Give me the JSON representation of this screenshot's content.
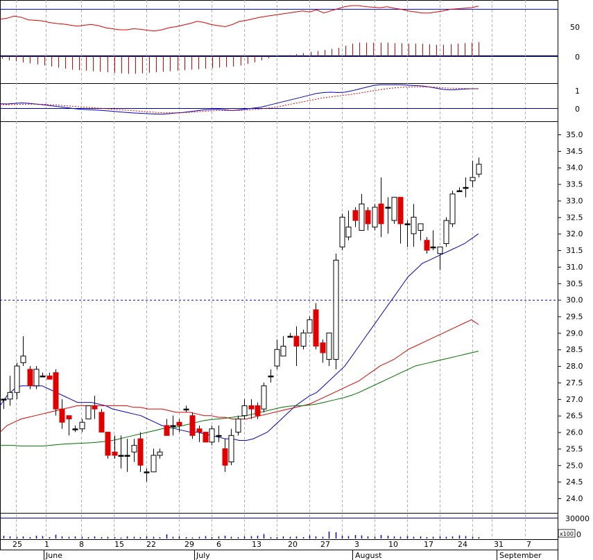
{
  "chart_data": [
    {
      "type": "line",
      "panel": "oscillator",
      "title": "",
      "y_ticks": [
        "50",
        "0"
      ],
      "reference_levels": [
        85
      ],
      "colors": {
        "line": "#e00000",
        "reference": "#0000aa"
      },
      "x": [
        "2009-05-22",
        "2009-05-25",
        "2009-05-26",
        "2009-05-27",
        "2009-05-28",
        "2009-05-29",
        "2009-06-01",
        "2009-06-02",
        "2009-06-03",
        "2009-06-04",
        "2009-06-05",
        "2009-06-08",
        "2009-06-09",
        "2009-06-10",
        "2009-06-11",
        "2009-06-12",
        "2009-06-15",
        "2009-06-16",
        "2009-06-17",
        "2009-06-18",
        "2009-06-19",
        "2009-06-22",
        "2009-06-23",
        "2009-06-24",
        "2009-06-25",
        "2009-06-26",
        "2009-06-29",
        "2009-06-30",
        "2009-07-01",
        "2009-07-02",
        "2009-07-03",
        "2009-07-06",
        "2009-07-07",
        "2009-07-08",
        "2009-07-09",
        "2009-07-10",
        "2009-07-13",
        "2009-07-14",
        "2009-07-15",
        "2009-07-16",
        "2009-07-17",
        "2009-07-20",
        "2009-07-21",
        "2009-07-22",
        "2009-07-23",
        "2009-07-24",
        "2009-07-27",
        "2009-07-28",
        "2009-07-29",
        "2009-07-30",
        "2009-07-31",
        "2009-08-03",
        "2009-08-04",
        "2009-08-05",
        "2009-08-06",
        "2009-08-07",
        "2009-08-10",
        "2009-08-11",
        "2009-08-12",
        "2009-08-13",
        "2009-08-14",
        "2009-08-17",
        "2009-08-18",
        "2009-08-19",
        "2009-08-20",
        "2009-08-21",
        "2009-08-24",
        "2009-08-25",
        "2009-08-26"
      ],
      "values": [
        66,
        68,
        72,
        70,
        65,
        64,
        63,
        60,
        58,
        57,
        55,
        53,
        55,
        56,
        54,
        50,
        48,
        46,
        46,
        48,
        47,
        45,
        44,
        46,
        50,
        52,
        55,
        58,
        62,
        60,
        56,
        54,
        52,
        56,
        62,
        64,
        67,
        70,
        72,
        74,
        76,
        78,
        80,
        82,
        80,
        84,
        78,
        82,
        86,
        90,
        92,
        92,
        90,
        89,
        88,
        90,
        87,
        85,
        82,
        80,
        78,
        78,
        80,
        82,
        85,
        86,
        87,
        88,
        91
      ]
    },
    {
      "type": "bar",
      "panel": "histogram",
      "title": "",
      "y_ticks": [
        "0"
      ],
      "colors": {
        "bar": "#e00000",
        "zero": "#0000aa"
      },
      "values": [
        -0.05,
        -0.08,
        -0.1,
        -0.12,
        -0.14,
        -0.16,
        -0.18,
        -0.2,
        -0.22,
        -0.24,
        -0.26,
        -0.27,
        -0.28,
        -0.29,
        -0.3,
        -0.31,
        -0.32,
        -0.33,
        -0.34,
        -0.34,
        -0.33,
        -0.32,
        -0.31,
        -0.3,
        -0.29,
        -0.28,
        -0.27,
        -0.26,
        -0.25,
        -0.24,
        -0.23,
        -0.22,
        -0.21,
        -0.2,
        -0.18,
        -0.15,
        -0.12,
        -0.08,
        -0.04,
        0,
        0,
        0.02,
        0.04,
        0.06,
        0.08,
        0.1,
        0.12,
        0.14,
        0.16,
        0.2,
        0.24,
        0.26,
        0.26,
        0.26,
        0.26,
        0.26,
        0.25,
        0.25,
        0.24,
        0.24,
        0.24,
        0.23,
        0.22,
        0.22,
        0.23,
        0.24,
        0.25,
        0.26,
        0.27
      ]
    },
    {
      "type": "line",
      "panel": "macd",
      "title": "",
      "y_ticks": [
        "1",
        "0"
      ],
      "colors": {
        "macd": "#0000cc",
        "signal": "#e00000",
        "zero": "#0000aa"
      },
      "series": [
        {
          "values": [
            0.25,
            0.24,
            0.27,
            0.3,
            0.28,
            0.24,
            0.2,
            0.15,
            0.1,
            0.05,
            0.0,
            -0.05,
            -0.08,
            -0.1,
            -0.12,
            -0.15,
            -0.18,
            -0.22,
            -0.25,
            -0.28,
            -0.3,
            -0.32,
            -0.34,
            -0.35,
            -0.32,
            -0.28,
            -0.25,
            -0.2,
            -0.15,
            -0.1,
            -0.08,
            -0.06,
            -0.1,
            -0.14,
            -0.1,
            -0.05,
            0.0,
            0.05,
            0.15,
            0.25,
            0.35,
            0.45,
            0.55,
            0.65,
            0.75,
            0.85,
            0.9,
            0.92,
            0.9,
            0.92,
            1.0,
            1.1,
            1.2,
            1.3,
            1.35,
            1.35,
            1.35,
            1.35,
            1.32,
            1.3,
            1.28,
            1.22,
            1.15,
            1.08,
            1.05,
            1.07,
            1.1,
            1.12,
            1.12
          ]
        },
        {
          "values": [
            0.2,
            0.2,
            0.21,
            0.22,
            0.23,
            0.23,
            0.22,
            0.2,
            0.18,
            0.15,
            0.12,
            0.09,
            0.06,
            0.03,
            0.0,
            -0.03,
            -0.06,
            -0.09,
            -0.12,
            -0.15,
            -0.18,
            -0.21,
            -0.24,
            -0.26,
            -0.27,
            -0.27,
            -0.26,
            -0.24,
            -0.21,
            -0.18,
            -0.16,
            -0.14,
            -0.14,
            -0.14,
            -0.13,
            -0.11,
            -0.08,
            -0.05,
            0.0,
            0.05,
            0.12,
            0.2,
            0.28,
            0.36,
            0.44,
            0.52,
            0.6,
            0.65,
            0.7,
            0.75,
            0.8,
            0.86,
            0.93,
            1.0,
            1.07,
            1.12,
            1.17,
            1.2,
            1.22,
            1.23,
            1.23,
            1.22,
            1.2,
            1.17,
            1.15,
            1.14,
            1.13,
            1.12,
            1.12
          ]
        }
      ]
    },
    {
      "type": "candlestick",
      "panel": "price",
      "title": "",
      "ylim": [
        23.5,
        35.5
      ],
      "y_ticks": [
        "35.0",
        "34.5",
        "34.0",
        "33.5",
        "33.0",
        "32.5",
        "32.0",
        "31.5",
        "31.0",
        "30.5",
        "30.0",
        "29.5",
        "29.0",
        "28.5",
        "28.0",
        "27.5",
        "27.0",
        "26.5",
        "26.0",
        "25.5",
        "25.0",
        "24.5",
        "24.0"
      ],
      "reference_level": 30.0,
      "colors": {
        "up": "#ffffff",
        "down": "#e00000",
        "doji": "#000000",
        "ma_blue": "#0000cc",
        "ma_red": "#e00000",
        "ma_green": "#007000",
        "ref": "#0000aa"
      },
      "ohlc": [
        [
          27.0,
          27.0,
          26.7,
          27.0
        ],
        [
          27.0,
          27.7,
          26.8,
          27.2
        ],
        [
          27.2,
          28.1,
          27.0,
          28.0
        ],
        [
          28.1,
          28.9,
          28.0,
          28.3
        ],
        [
          27.9,
          28.0,
          27.3,
          27.4
        ],
        [
          27.4,
          28.0,
          27.3,
          27.9
        ],
        [
          27.7,
          27.8,
          27.7,
          27.7
        ],
        [
          27.7,
          27.8,
          27.6,
          27.6
        ],
        [
          27.8,
          27.9,
          26.5,
          26.7
        ],
        [
          26.7,
          27.0,
          26.1,
          26.3
        ],
        [
          26.5,
          26.5,
          25.9,
          26.4
        ],
        [
          26.1,
          26.2,
          26.0,
          26.1
        ],
        [
          26.1,
          26.4,
          26.0,
          26.3
        ],
        [
          26.4,
          26.8,
          26.4,
          26.8
        ],
        [
          26.8,
          27.1,
          26.4,
          26.7
        ],
        [
          26.6,
          26.7,
          26.0,
          26.0
        ],
        [
          26.0,
          26.0,
          25.2,
          25.3
        ],
        [
          25.4,
          25.9,
          25.2,
          25.3
        ],
        [
          25.3,
          25.9,
          24.9,
          25.3
        ],
        [
          25.3,
          25.8,
          24.8,
          25.3
        ],
        [
          25.4,
          25.8,
          25.1,
          25.6
        ],
        [
          25.8,
          26.0,
          24.8,
          25.0
        ],
        [
          24.8,
          24.9,
          24.5,
          24.8
        ],
        [
          24.8,
          25.5,
          24.8,
          25.3
        ],
        [
          25.3,
          25.5,
          25.2,
          25.4
        ],
        [
          26.2,
          26.4,
          25.9,
          25.9
        ],
        [
          26.2,
          26.5,
          25.9,
          26.2
        ],
        [
          26.3,
          26.4,
          26.0,
          26.2
        ],
        [
          26.7,
          26.8,
          26.6,
          26.7
        ],
        [
          26.5,
          26.6,
          25.8,
          25.9
        ],
        [
          26.1,
          26.2,
          25.7,
          26.0
        ],
        [
          26.0,
          26.0,
          25.7,
          25.7
        ],
        [
          25.7,
          26.2,
          25.6,
          26.1
        ],
        [
          25.9,
          26.2,
          25.7,
          25.9
        ],
        [
          25.5,
          25.8,
          24.8,
          25.0
        ],
        [
          25.1,
          26.1,
          25.0,
          25.9
        ],
        [
          26.0,
          26.5,
          25.9,
          26.4
        ],
        [
          26.5,
          27.0,
          26.4,
          26.8
        ],
        [
          26.8,
          27.0,
          26.4,
          26.7
        ],
        [
          26.8,
          26.9,
          26.4,
          26.5
        ],
        [
          26.7,
          27.5,
          26.6,
          27.4
        ],
        [
          27.7,
          27.9,
          27.5,
          27.7
        ],
        [
          28.0,
          28.8,
          27.9,
          28.5
        ],
        [
          28.3,
          28.9,
          28.3,
          28.6
        ],
        [
          28.9,
          29.0,
          28.9,
          28.9
        ],
        [
          28.9,
          29.2,
          28.0,
          28.6
        ],
        [
          28.6,
          29.1,
          28.5,
          29.0
        ],
        [
          29.0,
          29.5,
          29.0,
          29.4
        ],
        [
          29.7,
          29.9,
          28.5,
          28.6
        ],
        [
          28.7,
          28.8,
          28.1,
          28.4
        ],
        [
          28.2,
          29.0,
          28.0,
          29.0
        ],
        [
          28.2,
          31.4,
          27.9,
          31.2
        ],
        [
          31.6,
          32.6,
          31.5,
          32.5
        ],
        [
          31.9,
          32.7,
          31.8,
          32.2
        ],
        [
          32.7,
          32.8,
          32.2,
          32.4
        ],
        [
          32.1,
          33.2,
          32.1,
          32.9
        ],
        [
          32.7,
          32.8,
          32.1,
          32.3
        ],
        [
          32.2,
          32.9,
          32.1,
          32.8
        ],
        [
          32.9,
          33.7,
          31.9,
          32.3
        ],
        [
          32.8,
          33.1,
          32.0,
          32.8
        ],
        [
          32.4,
          33.1,
          32.3,
          33.1
        ],
        [
          33.1,
          33.1,
          31.7,
          32.3
        ],
        [
          32.3,
          32.4,
          31.6,
          32.3
        ],
        [
          32.0,
          32.9,
          31.6,
          32.5
        ],
        [
          32.1,
          32.3,
          31.8,
          32.3
        ],
        [
          31.8,
          31.9,
          31.4,
          31.5
        ],
        [
          31.6,
          32.1,
          31.5,
          31.6
        ],
        [
          31.4,
          31.5,
          30.9,
          31.6
        ],
        [
          31.7,
          32.5,
          31.6,
          32.4
        ],
        [
          32.3,
          33.3,
          32.2,
          33.2
        ],
        [
          33.3,
          33.4,
          33.3,
          33.3
        ],
        [
          33.4,
          33.7,
          33.1,
          33.4
        ],
        [
          33.6,
          34.2,
          33.4,
          33.7
        ],
        [
          33.8,
          34.3,
          33.7,
          34.1
        ]
      ],
      "moving_averages": [
        {
          "color": "ma_blue",
          "values": [
            26.8,
            27.1,
            27.3,
            27.4,
            27.4,
            27.4,
            27.4,
            27.3,
            27.2,
            27.1,
            27.0,
            26.9,
            26.9,
            26.9,
            26.85,
            26.8,
            26.7,
            26.65,
            26.6,
            26.55,
            26.5,
            26.4,
            26.3,
            26.2,
            26.15,
            26.1,
            26.05,
            26.0,
            26.0,
            25.95,
            25.9,
            25.85,
            25.8,
            25.8,
            25.75,
            25.75,
            25.8,
            25.9,
            26.0,
            26.2,
            26.4,
            26.6,
            26.8,
            26.95,
            27.1,
            27.2,
            27.4,
            27.6,
            27.8,
            28.0,
            28.3,
            28.6,
            28.9,
            29.2,
            29.5,
            29.8,
            30.1,
            30.4,
            30.7,
            30.9,
            31.1,
            31.2,
            31.3,
            31.4,
            31.5,
            31.6,
            31.7,
            31.85,
            32.0
          ]
        },
        {
          "color": "ma_red",
          "values": [
            26.0,
            26.2,
            26.3,
            26.4,
            26.45,
            26.5,
            26.55,
            26.6,
            26.65,
            26.7,
            26.75,
            26.8,
            26.8,
            26.8,
            26.8,
            26.8,
            26.8,
            26.8,
            26.8,
            26.75,
            26.75,
            26.7,
            26.7,
            26.7,
            26.65,
            26.6,
            26.6,
            26.6,
            26.55,
            26.5,
            26.5,
            26.45,
            26.45,
            26.4,
            26.4,
            26.4,
            26.45,
            26.5,
            26.55,
            26.6,
            26.65,
            26.7,
            26.75,
            26.8,
            26.85,
            26.95,
            27.05,
            27.15,
            27.25,
            27.35,
            27.45,
            27.55,
            27.7,
            27.85,
            28.0,
            28.1,
            28.2,
            28.35,
            28.5,
            28.6,
            28.7,
            28.8,
            28.9,
            29.0,
            29.1,
            29.2,
            29.3,
            29.4,
            29.25
          ]
        },
        {
          "color": "ma_green",
          "values": [
            25.6,
            25.6,
            25.6,
            25.58,
            25.58,
            25.58,
            25.58,
            25.6,
            25.62,
            25.64,
            25.65,
            25.66,
            25.67,
            25.68,
            25.7,
            25.72,
            25.75,
            25.8,
            25.85,
            25.9,
            25.95,
            26.0,
            26.05,
            26.1,
            26.12,
            26.15,
            26.2,
            26.25,
            26.3,
            26.35,
            26.38,
            26.4,
            26.42,
            26.45,
            26.48,
            26.5,
            26.55,
            26.6,
            26.65,
            26.7,
            26.75,
            26.78,
            26.8,
            26.8,
            26.82,
            26.85,
            26.9,
            26.95,
            27.0,
            27.05,
            27.12,
            27.2,
            27.3,
            27.4,
            27.5,
            27.6,
            27.7,
            27.8,
            27.9,
            28.0,
            28.05,
            28.1,
            28.15,
            28.2,
            28.25,
            28.3,
            28.35,
            28.4,
            28.45
          ]
        }
      ]
    },
    {
      "type": "bar",
      "panel": "volume",
      "title": "",
      "y_ticks": [
        "30000",
        "0"
      ],
      "y_multiplier": "x100",
      "colors": {
        "bar": "#0000cc",
        "reference": "#0000aa"
      },
      "values": [
        4000,
        3000,
        2500,
        3000,
        2000,
        4000,
        3500,
        2000,
        5500,
        3000,
        2500,
        3000,
        2500,
        2000,
        3000,
        2000,
        2500,
        2000,
        1500,
        3000,
        2500,
        2000,
        3000,
        2500,
        2000,
        6000,
        2500,
        3000,
        2000,
        1500,
        2500,
        3500,
        2000,
        3000,
        4000,
        2500,
        2000,
        3000,
        3500,
        4000,
        6500,
        2000,
        2000,
        3000,
        2500,
        3000,
        2000,
        4500,
        3000,
        2500,
        10000,
        9000,
        4000,
        3500,
        5000,
        4500,
        3000,
        2500,
        5000,
        4000,
        3000,
        2500,
        3500,
        2500,
        3000,
        2000,
        2500,
        3000,
        2500,
        3000,
        4500,
        3500,
        2500,
        2000
      ]
    }
  ],
  "x_axis": {
    "day_ticks": [
      "25",
      "1",
      "8",
      "15",
      "22",
      "29",
      "6",
      "13",
      "20",
      "27",
      "3",
      "10",
      "17",
      "24",
      "31",
      "7"
    ],
    "months": [
      "June",
      "July",
      "August",
      "September"
    ]
  }
}
